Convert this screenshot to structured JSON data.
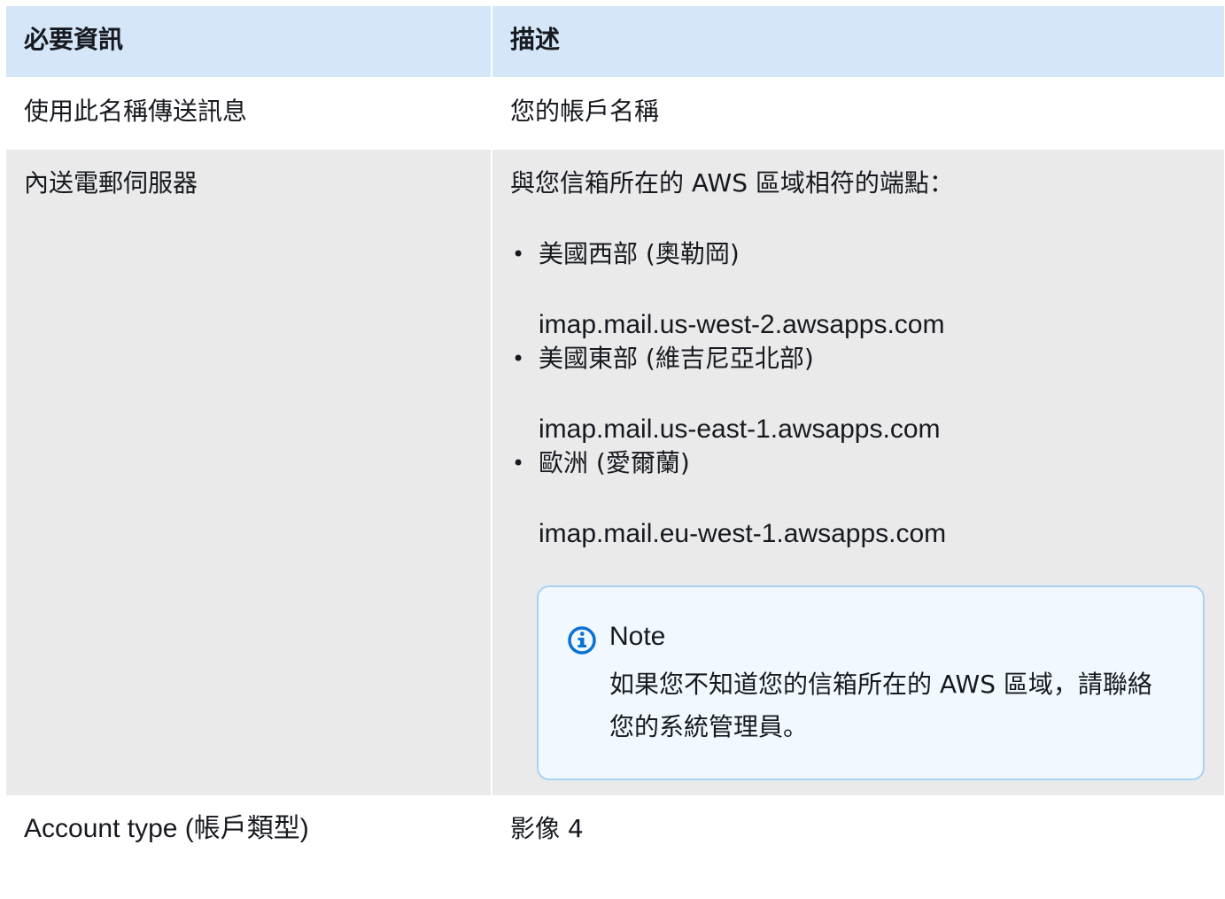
{
  "header": {
    "col1": "必要資訊",
    "col2": "描述"
  },
  "rows": {
    "name": {
      "label": "使用此名稱傳送訊息",
      "value": "您的帳戶名稱"
    },
    "server": {
      "label": "內送電郵伺服器",
      "intro": "與您信箱所在的 AWS 區域相符的端點：",
      "regions": [
        {
          "name": "美國西部 (奧勒岡)",
          "endpoint": "imap.mail.us-west-2.awsapps.com"
        },
        {
          "name": "美國東部 (維吉尼亞北部)",
          "endpoint": "imap.mail.us-east-1.awsapps.com"
        },
        {
          "name": "歐洲 (愛爾蘭)",
          "endpoint": "imap.mail.eu-west-1.awsapps.com"
        }
      ],
      "note": {
        "icon": "info-icon",
        "title": "Note",
        "body": "如果您不知道您的信箱所在的 AWS 區域，請聯絡您的系統管理員。"
      }
    },
    "account_type": {
      "label": "Account type (帳戶類型)",
      "value": "影像 4"
    }
  },
  "colors": {
    "header_bg": "#d4e6f7",
    "row_alt_bg": "#eaeaeb",
    "note_bg": "#f1f8ff",
    "note_border": "#a9d1f5",
    "info_icon": "#0972d3"
  }
}
